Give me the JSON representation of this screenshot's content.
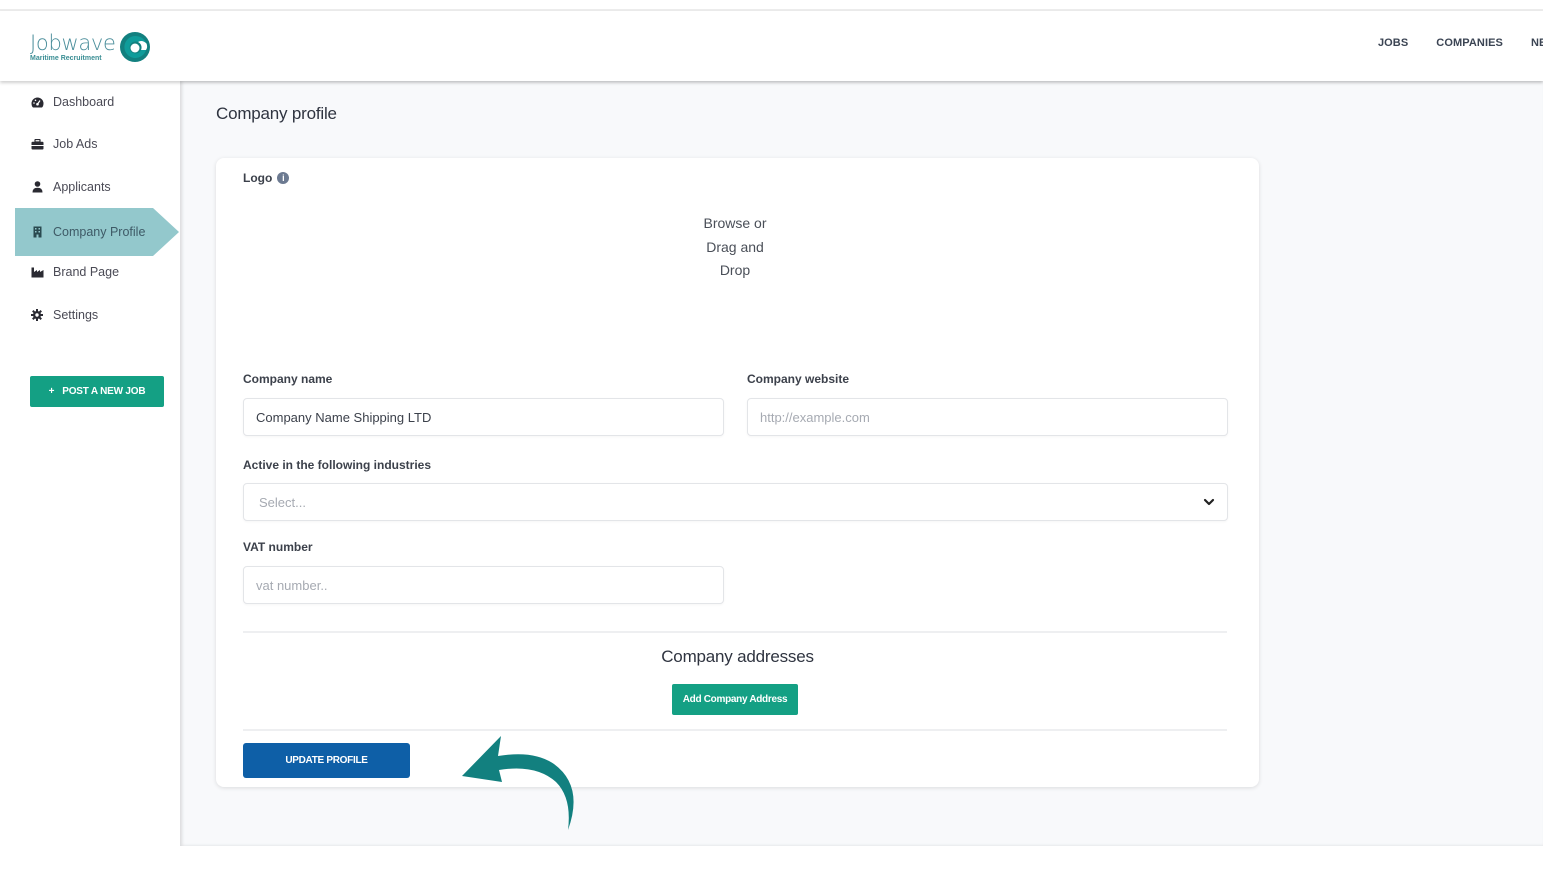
{
  "brand": {
    "name": "Jobwave",
    "tagline": "Maritime Recruitment",
    "colors": {
      "teal": "#12807f",
      "accent_green": "#14a084",
      "primary_blue": "#0e5fa7",
      "active_nav": "#93c8cc"
    }
  },
  "topnav": {
    "items": [
      {
        "label": "JOBS"
      },
      {
        "label": "COMPANIES"
      },
      {
        "label": "NE"
      }
    ]
  },
  "sidebar": {
    "items": [
      {
        "label": "Dashboard",
        "icon": "tachometer-icon",
        "active": false
      },
      {
        "label": "Job Ads",
        "icon": "briefcase-icon",
        "active": false
      },
      {
        "label": "Applicants",
        "icon": "user-icon",
        "active": false
      },
      {
        "label": "Company Profile",
        "icon": "building-icon",
        "active": true
      },
      {
        "label": "Brand Page",
        "icon": "industry-icon",
        "active": false
      },
      {
        "label": "Settings",
        "icon": "gear-icon",
        "active": false
      }
    ],
    "post_button": {
      "icon": "+",
      "label": "POST A NEW JOB"
    }
  },
  "main": {
    "title": "Company profile",
    "form": {
      "logo": {
        "label": "Logo",
        "info_icon": "i",
        "dropzone_text": "Browse or Drag and Drop"
      },
      "company_name": {
        "label": "Company name",
        "value": "Company Name Shipping LTD",
        "placeholder": ""
      },
      "company_website": {
        "label": "Company website",
        "value": "",
        "placeholder": "http://example.com"
      },
      "industries": {
        "label": "Active in the following industries",
        "placeholder": "Select..."
      },
      "vat_number": {
        "label": "VAT number",
        "value": "",
        "placeholder": "vat number.."
      },
      "addresses": {
        "title": "Company addresses",
        "add_button": "Add Company Address"
      },
      "update_button": "UPDATE PROFILE"
    }
  },
  "annotation": {
    "type": "curved-arrow",
    "points_to": "update-profile-button",
    "color": "#12807f"
  }
}
